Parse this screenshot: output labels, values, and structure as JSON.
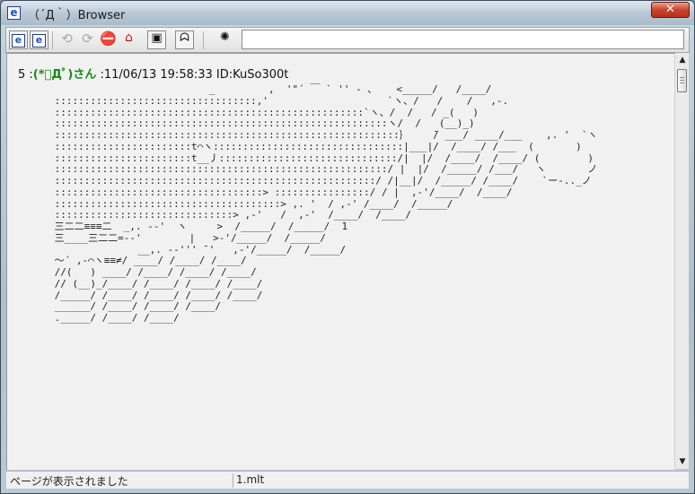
{
  "window": {
    "title": "（´Д｀）Browser",
    "icon": "ie-page-icon",
    "close_label": "✕"
  },
  "toolbar": {
    "buttons": [
      {
        "name": "ie-open-button",
        "glyph": "e"
      },
      {
        "name": "ie-open-new-button",
        "glyph": "e"
      },
      {
        "name": "back-button",
        "glyph": "⟲"
      },
      {
        "name": "forward-button",
        "glyph": "⟳"
      },
      {
        "name": "stop-button",
        "glyph": "⛔"
      },
      {
        "name": "home-button",
        "glyph": "⌂"
      },
      {
        "name": "window-list-button",
        "glyph": "▣"
      },
      {
        "name": "aa-face-button",
        "glyph": "ᗣ"
      },
      {
        "name": "settings-button",
        "glyph": "✺"
      }
    ],
    "url_value": ""
  },
  "post": {
    "number": "5",
    "name": "(*ﾟДﾟ)さん",
    "date": "11/06/13 19:58:33",
    "id": "ID:KuSo300t",
    "ascii_art": "                           _         ,  '\"´ ￣ ` '' - ､    <_____/   /____/\n ::::::::::::::::::::::::::::::::::,'                    `ヽ、/   /    /   ,-.\n ::::::::::::::::::::::::::::::::::::::::::::::::::::`ヽ、/  /   / _(   )\n ::::::::::::::::::::::::::::::::::::::::::::::::::::::::ヽ/  /   (__)_)\n ::::::::::::::::::::::::::::::::::::::::::::::::::::::::::｝    ̄/ ___/ ____/___    ,. '  `ヽ\n :::::::::::::::::::::::t⌒ヽ::::::::::::::::::::::::::::::::|___|/  /____/ /___  (       )\n :::::::::::::::::::::::t__丿::::::::::::::::::::::::::::::/|  |/  /____/  /____/ (        )\n ::::::::::::::::::::::::::::::::::::::::::::::::::::::::/ |  |/  /_____/ /___/   ヽ       ノ\n ::::::::::::::::::::::::::::::::::::::::::::::::::::::/ /|__|/  /_____/ /____/    `ー-.._ノ\n :::::::::::::::::::::::::::::::::::> ::::::::::::::::/ / |  ,-'/____/  /____/\n ::::::::::::::::::::::::::::::::::::::> ,. '  / ,-' /____/  /_____/\n ::::::::::::::::::::::::::::::> ,-'   /  ,-'  /____/  /____/\n 三二二≡≡≡二  _,. -‐'  ヽ     >  /_____/  /_____/  1\n 三____三二二=-‐'        |   >-'/_____/  /_____/\n               __,. -‐''' ̄ '   ,-'/_____/  /_____/\n ～´ ,-⌒ヽ≡≡≠/ ____/ /____/ /____/\n //(   ) ____/ /____/ /____/ /____/\n // (__)_/____/ /____/ /____/ /____/\n /_____/ /____/ /____/ /____/ /____/\n ______/ /____/ /____/ /____/\n ._____/ /____/ /____/"
  },
  "scrollbar": {
    "up_glyph": "▲",
    "down_glyph": "▼"
  },
  "status": {
    "text": "ページが表示されました",
    "file": "1.mlt"
  }
}
